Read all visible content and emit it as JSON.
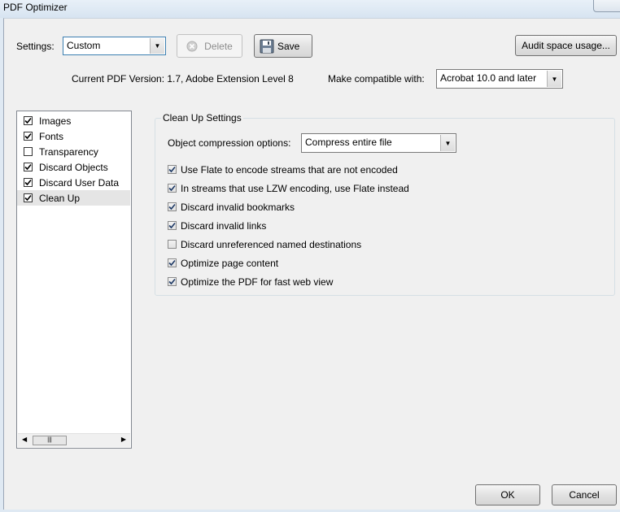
{
  "window": {
    "title": "PDF Optimizer"
  },
  "toolbar": {
    "settings_label": "Settings:",
    "settings_value": "Custom",
    "delete_label": "Delete",
    "save_label": "Save",
    "audit_label": "Audit space usage..."
  },
  "info": {
    "current_version": "Current PDF Version: 1.7, Adobe Extension Level 8",
    "compat_label": "Make compatible with:",
    "compat_value": "Acrobat 10.0 and later"
  },
  "panels": [
    {
      "label": "Images",
      "checked": true,
      "selected": false
    },
    {
      "label": "Fonts",
      "checked": true,
      "selected": false
    },
    {
      "label": "Transparency",
      "checked": false,
      "selected": false
    },
    {
      "label": "Discard Objects",
      "checked": true,
      "selected": false
    },
    {
      "label": "Discard User Data",
      "checked": true,
      "selected": false
    },
    {
      "label": "Clean Up",
      "checked": true,
      "selected": true
    }
  ],
  "cleanup": {
    "group_title": "Clean Up Settings",
    "compression_label": "Object compression options:",
    "compression_value": "Compress entire file",
    "options": [
      {
        "label": "Use Flate to encode streams that are not encoded",
        "checked": true
      },
      {
        "label": "In streams that use LZW encoding, use Flate instead",
        "checked": true
      },
      {
        "label": "Discard invalid bookmarks",
        "checked": true
      },
      {
        "label": "Discard invalid links",
        "checked": true
      },
      {
        "label": "Discard unreferenced named destinations",
        "checked": false
      },
      {
        "label": "Optimize page content",
        "checked": true
      },
      {
        "label": "Optimize the PDF for fast web view",
        "checked": true
      }
    ]
  },
  "footer": {
    "ok_label": "OK",
    "cancel_label": "Cancel"
  }
}
